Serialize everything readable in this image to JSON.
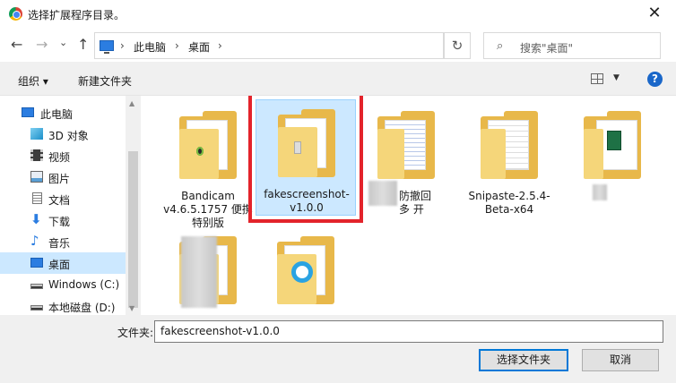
{
  "window": {
    "title": "选择扩展程序目录。",
    "close_glyph": "✕"
  },
  "nav": {
    "back": "←",
    "forward": "→",
    "dropdown": "⌄",
    "up": "↑",
    "refresh": "↻"
  },
  "address": {
    "crumbs": [
      "此电脑",
      "桌面"
    ],
    "separator": "›",
    "dropdown": "⌄"
  },
  "search": {
    "placeholder": "搜索\"桌面\""
  },
  "commands": {
    "organize": "组织 ▾",
    "new_folder": "新建文件夹"
  },
  "sidebar": {
    "items": [
      {
        "label": "此电脑",
        "icon": "pc-icon"
      },
      {
        "label": "3D 对象",
        "icon": "3d-objects-icon"
      },
      {
        "label": "视频",
        "icon": "video-icon"
      },
      {
        "label": "图片",
        "icon": "pictures-icon"
      },
      {
        "label": "文档",
        "icon": "documents-icon"
      },
      {
        "label": "下载",
        "icon": "downloads-icon"
      },
      {
        "label": "音乐",
        "icon": "music-icon"
      },
      {
        "label": "桌面",
        "icon": "desktop-icon",
        "selected": true
      },
      {
        "label": "Windows (C:)",
        "icon": "drive-c-icon"
      },
      {
        "label": "本地磁盘 (D:)",
        "icon": "drive-d-icon"
      }
    ]
  },
  "files": [
    {
      "name": "Bandicam v4.6.5.1757 便携特别版"
    },
    {
      "name": "fakescreenshot-v1.0.0",
      "selected": true
    },
    {
      "name": "防撤回 多 开"
    },
    {
      "name": "Snipaste-2.5.4-Beta-x64"
    },
    {
      "name": ""
    },
    {
      "name": ""
    },
    {
      "name": ""
    }
  ],
  "bottom": {
    "folder_label": "文件夹:",
    "folder_value": "fakescreenshot-v1.0.0",
    "select_button": "选择文件夹",
    "cancel_button": "取消"
  },
  "colors": {
    "accent": "#0078d7",
    "selection": "#cce8ff",
    "highlight_box": "#e3232b",
    "folder": "#e8b84a"
  }
}
